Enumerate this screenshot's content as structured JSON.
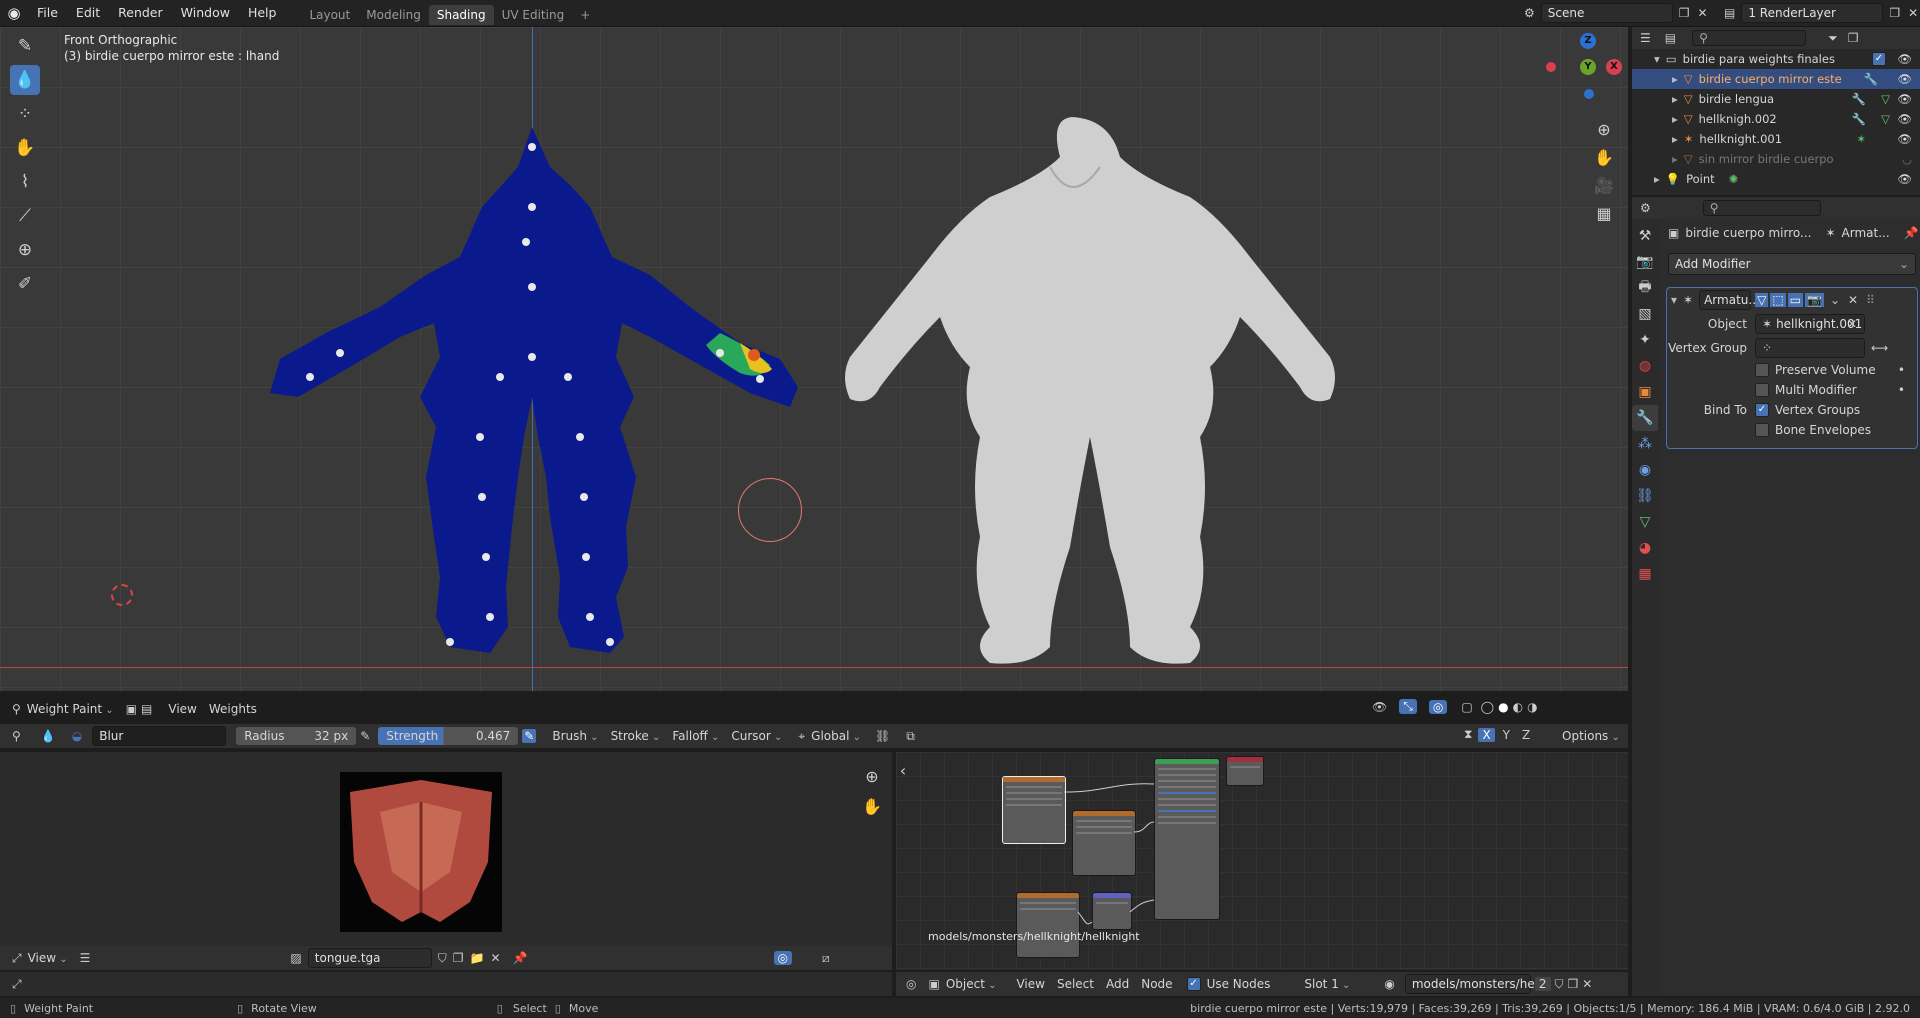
{
  "topbar": {
    "menus": [
      "File",
      "Edit",
      "Render",
      "Window",
      "Help"
    ],
    "workspaces": [
      "Layout",
      "Modeling",
      "Shading",
      "UV Editing"
    ],
    "active_workspace": "Shading",
    "add_tab": "+",
    "scene": "Scene",
    "render_layer": "1 RenderLayer"
  },
  "viewport": {
    "view_name": "Front Orthographic",
    "object_info": "(3) birdie cuerpo mirror este : lhand",
    "mode": "Weight Paint",
    "menus": [
      "View",
      "Weights"
    ],
    "gizmo": {
      "z": "Z",
      "y": "Y",
      "x": "X"
    }
  },
  "tool_settings": {
    "brush": "Blur",
    "radius_label": "Radius",
    "radius_value": "32 px",
    "strength_label": "Strength",
    "strength_value": "0.467",
    "strength_fraction": 0.467,
    "menus": [
      "Brush",
      "Stroke",
      "Falloff",
      "Cursor"
    ],
    "orientation": "Global",
    "axes": [
      "X",
      "Y",
      "Z"
    ],
    "options": "Options"
  },
  "outliner": {
    "collection": "birdie para weights finales",
    "items": [
      {
        "name": "birdie cuerpo mirror este",
        "selected": true
      },
      {
        "name": "birdie lengua",
        "selected": false
      },
      {
        "name": "hellknigh.002",
        "selected": false
      },
      {
        "name": "hellknight.001",
        "selected": false
      },
      {
        "name": "sin mirror birdie cuerpo",
        "selected": false,
        "dim": true
      }
    ],
    "point": "Point"
  },
  "properties": {
    "object_name": "birdie cuerpo mirro...",
    "modifier_short": "Armat...",
    "add_modifier": "Add Modifier",
    "modifier_name": "Armatu...",
    "object_label": "Object",
    "object_value": "hellknight.001",
    "vertex_group_label": "Vertex Group",
    "vertex_group_value": "",
    "preserve_volume": {
      "label": "Preserve Volume",
      "checked": false
    },
    "multi_modifier": {
      "label": "Multi Modifier",
      "checked": false
    },
    "bind_to_label": "Bind To",
    "vertex_groups": {
      "label": "Vertex Groups",
      "checked": true
    },
    "bone_envelopes": {
      "label": "Bone Envelopes",
      "checked": false
    }
  },
  "image_editor": {
    "view": "View",
    "image_name": "tongue.tga"
  },
  "node_editor": {
    "path_overlay": "models/monsters/hellknight/hellknight",
    "object_mode": "Object",
    "menus": [
      "View",
      "Select",
      "Add",
      "Node"
    ],
    "use_nodes": "Use Nodes",
    "slot": "Slot 1",
    "material": "models/monsters/he...",
    "users": "2"
  },
  "statusbar": {
    "left_mode": "Weight Paint",
    "rotate": "Rotate View",
    "select": "Select",
    "move": "Move",
    "stats": "birdie cuerpo mirror este | Verts:19,979 | Faces:39,269 | Tris:39,269 | Objects:1/5 | Memory: 186.4 MiB | VRAM: 0.6/4.0 GiB | 2.92.0"
  },
  "colors": {
    "accent": "#4772b3",
    "selection": "#334d80",
    "mesh_weight": "#0a1a8c",
    "mesh_gray": "#cfcfcf",
    "axis_z": "#2e6fd1",
    "axis_y": "#6aa52a",
    "axis_x": "#d8404f"
  }
}
